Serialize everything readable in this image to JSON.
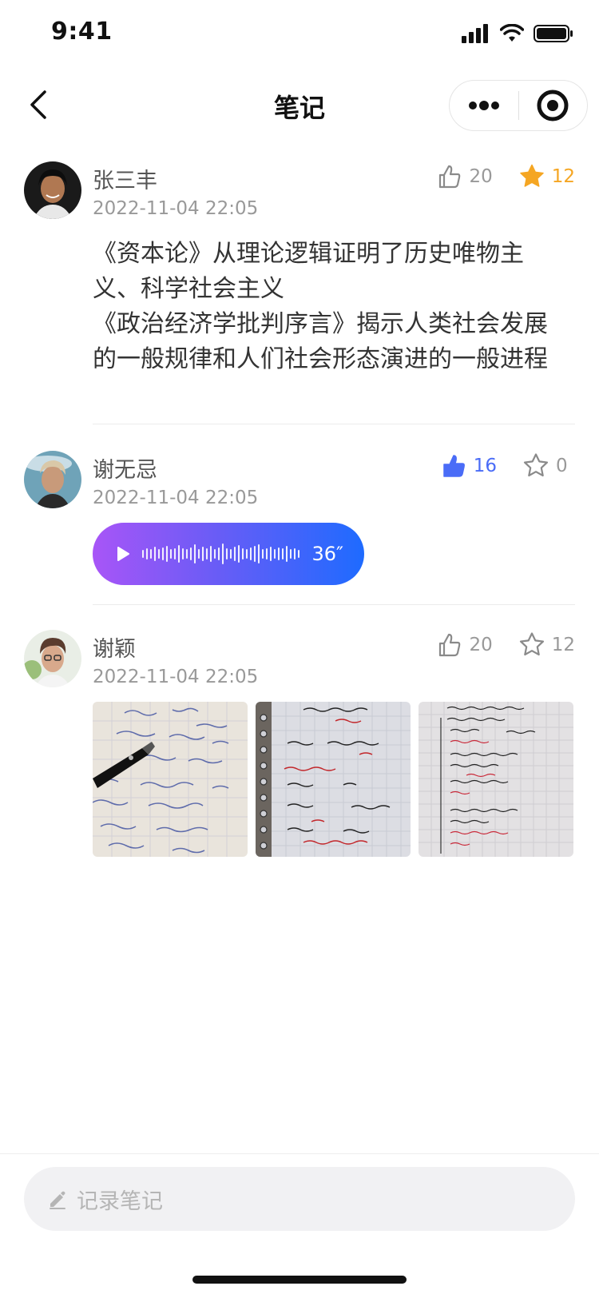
{
  "status_bar": {
    "time": "9:41"
  },
  "nav": {
    "title": "笔记"
  },
  "notes": [
    {
      "author": "张三丰",
      "time": "2022-11-04 22:05",
      "likes": "20",
      "stars": "12",
      "liked": false,
      "starred": true,
      "text_lines": [
        "《资本论》从理论逻辑证明了历史唯物主义、科学社会主义",
        "《政治经济学批判序言》揭示人类社会发展的一般规律和人们社会形态演进的一般进程"
      ]
    },
    {
      "author": "谢无忌",
      "time": "2022-11-04 22:05",
      "likes": "16",
      "stars": "0",
      "liked": true,
      "starred": false,
      "voice_duration": "36″"
    },
    {
      "author": "谢颖",
      "time": "2022-11-04 22:05",
      "likes": "20",
      "stars": "12",
      "liked": false,
      "starred": false,
      "images": [
        "handwritten-math-with-pen",
        "notebook-notes-red-black",
        "notebook-notes-dense"
      ]
    }
  ],
  "input": {
    "placeholder": "记录笔记"
  },
  "colors": {
    "accent_blue": "#4a6cf7",
    "star_gold": "#f5a623",
    "voice_start": "#a855f7",
    "voice_end": "#1e6bff"
  }
}
